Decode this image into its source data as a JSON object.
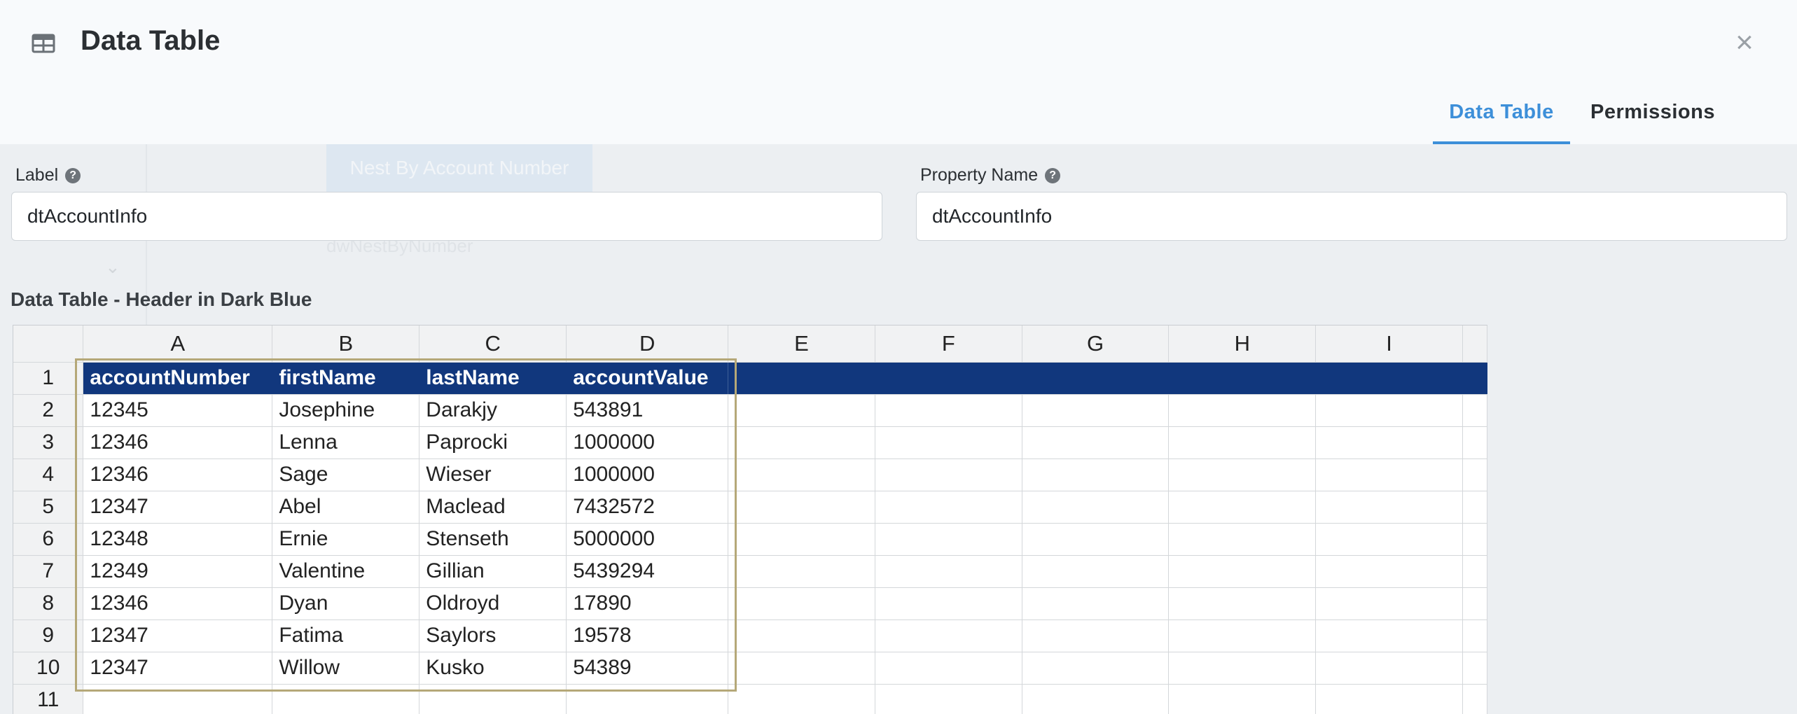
{
  "header": {
    "title": "Data Table",
    "title_icon": "table-icon",
    "close_label": "×",
    "tabs": [
      {
        "label": "Data Table",
        "active": true
      },
      {
        "label": "Permissions",
        "active": false
      }
    ]
  },
  "background": {
    "button_label": "Nest By Account Number",
    "node_label": "dwNestByNumber"
  },
  "form": {
    "label_field": {
      "label": "Label",
      "value": "dtAccountInfo"
    },
    "property_field": {
      "label": "Property Name",
      "value": "dtAccountInfo"
    },
    "help_glyph": "?"
  },
  "section_title": "Data Table - Header in Dark Blue",
  "colors": {
    "accent": "#3d8fd9",
    "header_row_bg": "#11377d",
    "selection_border": "#b5a878"
  },
  "spreadsheet": {
    "columns": [
      "A",
      "B",
      "C",
      "D",
      "E",
      "F",
      "G",
      "H",
      "I"
    ],
    "row_numbers": [
      "1",
      "2",
      "3",
      "4",
      "5",
      "6",
      "7",
      "8",
      "9",
      "10",
      "11"
    ],
    "header_row": [
      "accountNumber",
      "firstName",
      "lastName",
      "accountValue"
    ],
    "rows": [
      [
        "12345",
        "Josephine",
        "Darakjy",
        "543891"
      ],
      [
        "12346",
        "Lenna",
        "Paprocki",
        "1000000"
      ],
      [
        "12346",
        "Sage",
        "Wieser",
        "1000000"
      ],
      [
        "12347",
        "Abel",
        "Maclead",
        "7432572"
      ],
      [
        "12348",
        "Ernie",
        "Stenseth",
        "5000000"
      ],
      [
        "12349",
        "Valentine",
        "Gillian",
        "5439294"
      ],
      [
        "12346",
        "Dyan",
        "Oldroyd",
        "17890"
      ],
      [
        "12347",
        "Fatima",
        "Saylors",
        "19578"
      ],
      [
        "12347",
        "Willow",
        "Kusko",
        "54389"
      ],
      [
        "",
        "",
        "",
        ""
      ]
    ]
  }
}
